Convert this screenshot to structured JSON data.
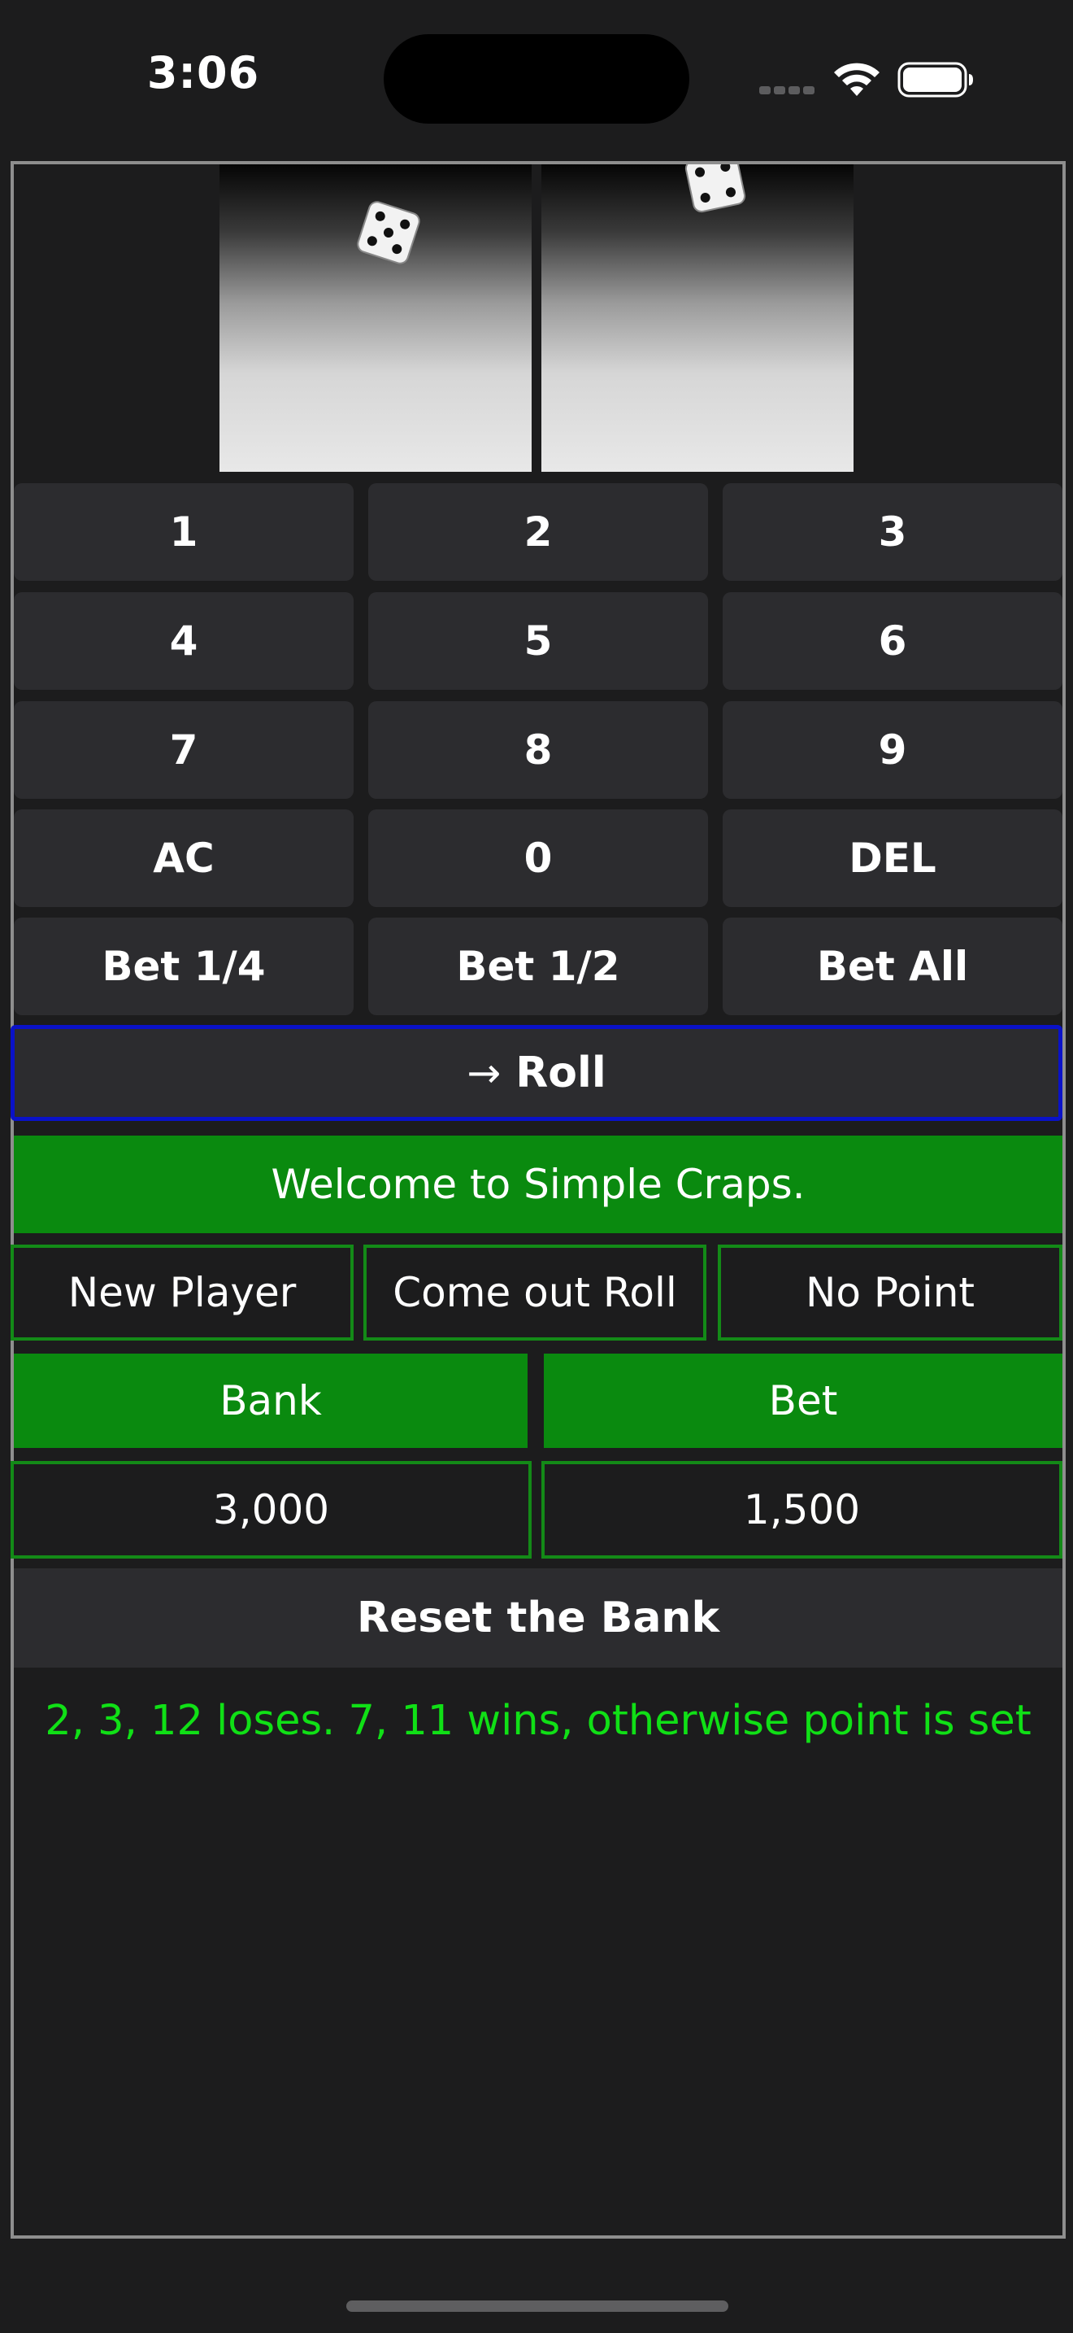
{
  "status_bar": {
    "time": "3:06"
  },
  "dice": {
    "left_face": 5,
    "right_face": 4
  },
  "keypad": {
    "keys": [
      "1",
      "2",
      "3",
      "4",
      "5",
      "6",
      "7",
      "8",
      "9",
      "AC",
      "0",
      "DEL",
      "Bet 1/4",
      "Bet 1/2",
      "Bet All"
    ]
  },
  "roll": {
    "label": "Roll",
    "icon": "arrow-right-icon"
  },
  "message": "Welcome to Simple Craps.",
  "status": {
    "player": "New Player",
    "phase": "Come out Roll",
    "point": "No Point"
  },
  "bank": {
    "label": "Bank",
    "value": "3,000"
  },
  "bet": {
    "label": "Bet",
    "value": "1,500"
  },
  "reset_label": "Reset the Bank",
  "rules": "2, 3, 12 loses. 7, 11 wins, otherwise point is set",
  "colors": {
    "background": "#1c1c1d",
    "key": "#2c2c2f",
    "green": "#0a8a0f",
    "green_border": "#138a17",
    "rules_text": "#10e016",
    "roll_border": "#0a12c8"
  }
}
